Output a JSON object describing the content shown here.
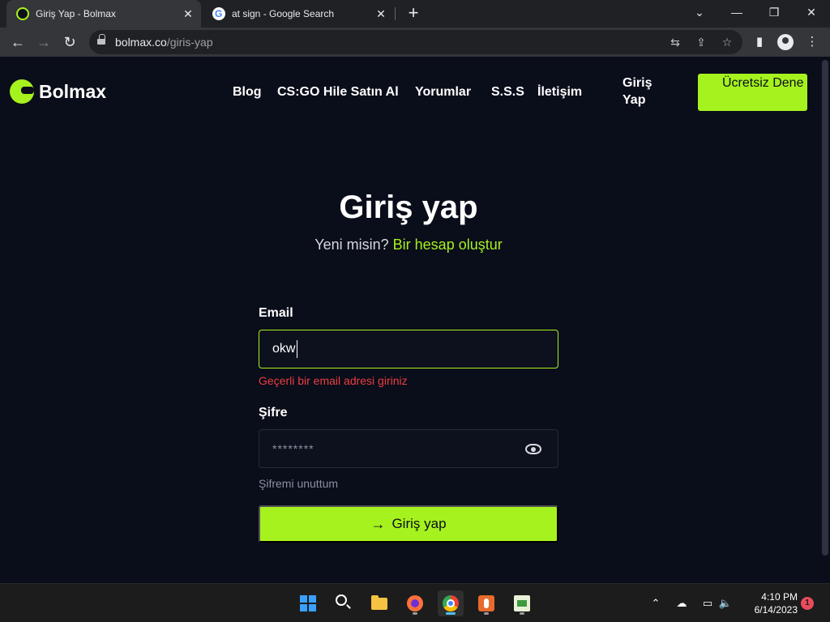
{
  "browser": {
    "tabs": [
      {
        "title": "Giriş Yap - Bolmax",
        "active": true
      },
      {
        "title": "at sign - Google Search",
        "active": false
      }
    ],
    "new_tab_label": "+",
    "window_controls": {
      "dropdown": "⌄",
      "minimize": "—",
      "restore": "❐",
      "close": "✕"
    },
    "tab_close": "✕",
    "address": {
      "domain": "bolmax.co",
      "path": "/giris-yap"
    },
    "nav_icons": {
      "back": "←",
      "forward": "→",
      "reload": "↻"
    },
    "toolbar_icons": {
      "translate": "⇆",
      "share": "⇪",
      "bookmark": "☆",
      "sidepanel": "▮",
      "menu": "⋮"
    }
  },
  "site": {
    "brand": "Bolmax",
    "nav": [
      "Blog",
      "CS:GO Hile Satın Al",
      "Yorumlar",
      "S.S.S",
      "İletişim"
    ],
    "login_link": "Giriş Yap",
    "cta": "Ücretsiz Dene"
  },
  "form": {
    "heading": "Giriş yap",
    "prompt": "Yeni misin?",
    "signup_link": "Bir hesap oluştur",
    "email_label": "Email",
    "email_value": "okw",
    "email_error": "Geçerli bir email adresi giriniz",
    "password_label": "Şifre",
    "password_value": "********",
    "forgot_link": "Şifremi unuttum",
    "submit_arrow": "→",
    "submit_label": "Giriş yap"
  },
  "taskbar": {
    "apps": [
      "windows-start",
      "search",
      "file-explorer",
      "firefox",
      "chrome",
      "hand-app",
      "notepad"
    ],
    "tray_up": "⌃",
    "tray_cloud": "☁",
    "tray_network": "▭",
    "tray_volume": "🔈",
    "time": "4:10 PM",
    "date": "6/14/2023",
    "notifications": "1"
  },
  "colors": {
    "accent": "#a6f21e",
    "page_bg": "#0a0d1a",
    "error": "#ec3f3f"
  }
}
